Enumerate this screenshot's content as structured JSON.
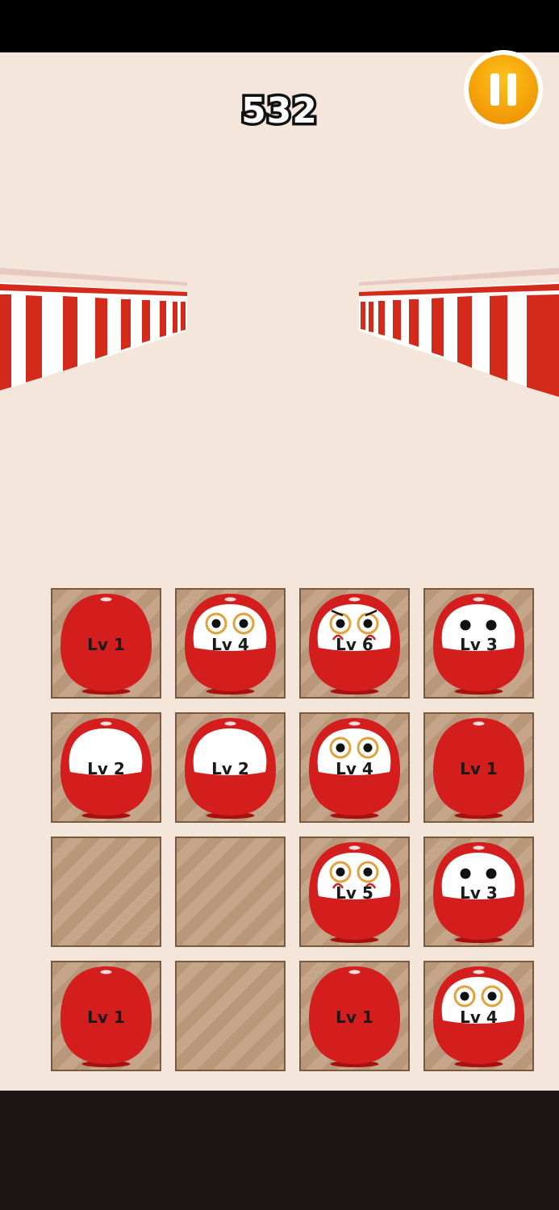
{
  "score": "532",
  "pause_button": {
    "icon": "pause-icon",
    "color": "#f5a20a"
  },
  "colors": {
    "background": "#f4e6da",
    "daruma_red": "#d41e1e",
    "tile": "#c6a68a",
    "tile_border": "#7a5a3a",
    "fence_red": "#d42a1c"
  },
  "board": {
    "rows": [
      [
        {
          "level": 1,
          "label": "Lv 1"
        },
        {
          "level": 4,
          "label": "Lv 4"
        },
        {
          "level": 6,
          "label": "Lv 6"
        },
        {
          "level": 3,
          "label": "Lv 3"
        }
      ],
      [
        {
          "level": 2,
          "label": "Lv 2"
        },
        {
          "level": 2,
          "label": "Lv 2"
        },
        {
          "level": 4,
          "label": "Lv 4"
        },
        {
          "level": 1,
          "label": "Lv 1"
        }
      ],
      [
        {
          "level": 0,
          "label": ""
        },
        {
          "level": 0,
          "label": ""
        },
        {
          "level": 5,
          "label": "Lv 5"
        },
        {
          "level": 3,
          "label": "Lv 3"
        }
      ],
      [
        {
          "level": 1,
          "label": "Lv 1"
        },
        {
          "level": 0,
          "label": ""
        },
        {
          "level": 1,
          "label": "Lv 1"
        },
        {
          "level": 4,
          "label": "Lv 4"
        }
      ]
    ]
  }
}
